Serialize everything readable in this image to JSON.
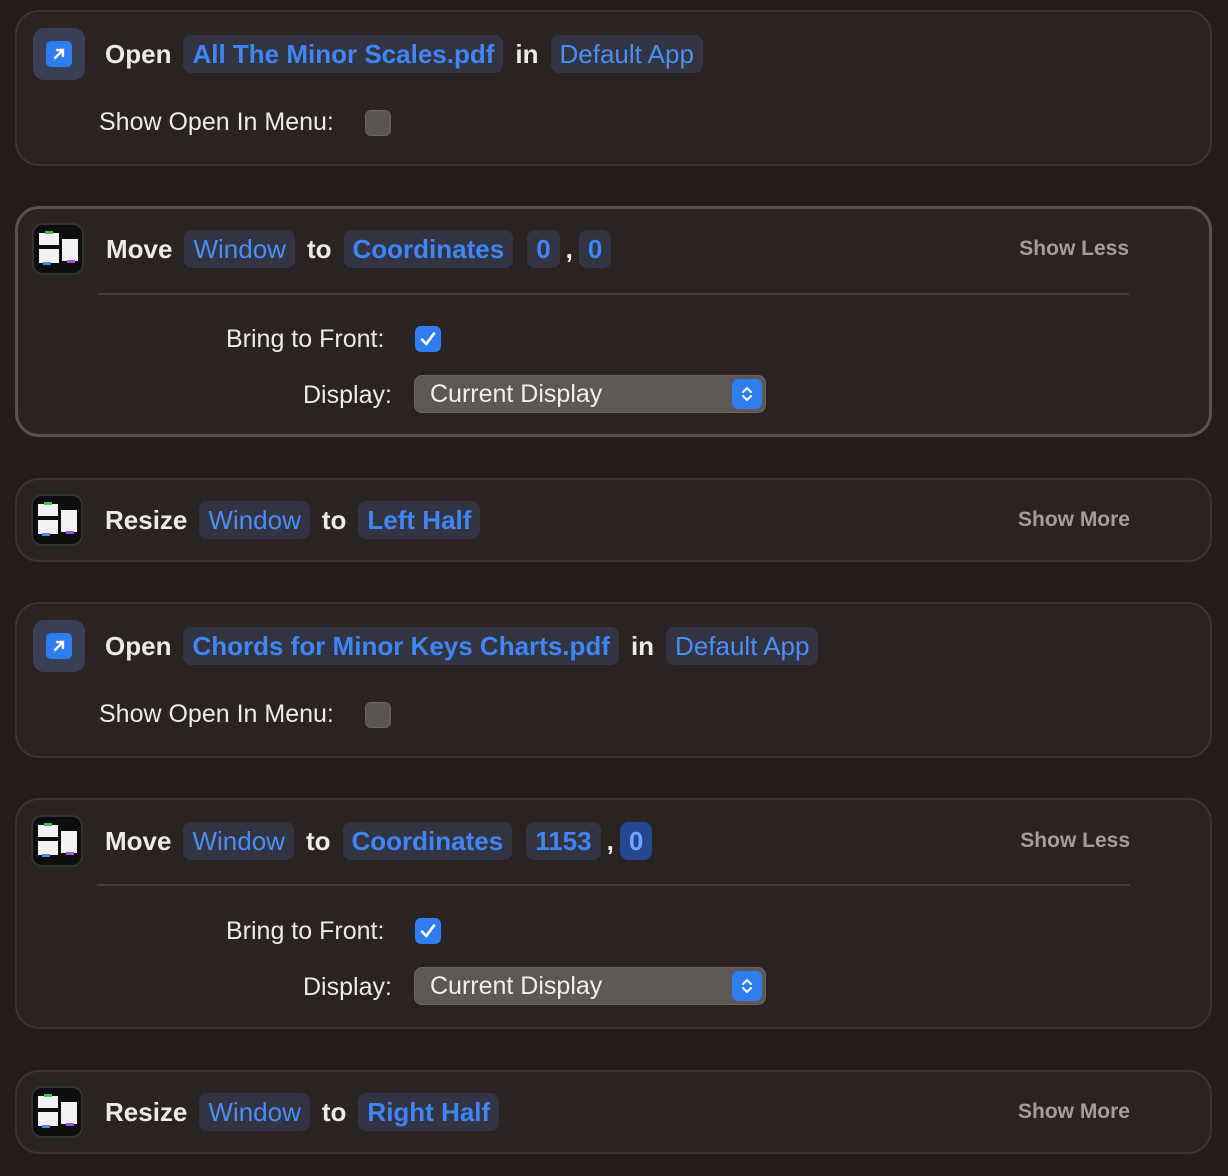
{
  "actions": [
    {
      "verb": "Open",
      "file": "All The Minor Scales.pdf",
      "in": "in",
      "app": "Default App",
      "option_label": "Show Open In Menu:"
    },
    {
      "verb": "Move",
      "target": "Window",
      "to": "to",
      "dest": "Coordinates",
      "x": "0",
      "comma": ",",
      "y": "0",
      "toggle": "Show Less",
      "bring_label": "Bring to Front:",
      "display_label": "Display:",
      "display_value": "Current Display"
    },
    {
      "verb": "Resize",
      "target": "Window",
      "to": "to",
      "size": "Left Half",
      "toggle": "Show More"
    },
    {
      "verb": "Open",
      "file": "Chords for Minor Keys Charts.pdf",
      "in": "in",
      "app": "Default App",
      "option_label": "Show Open In Menu:"
    },
    {
      "verb": "Move",
      "target": "Window",
      "to": "to",
      "dest": "Coordinates",
      "x": "1153",
      "comma": ",",
      "y": "0",
      "toggle": "Show Less",
      "bring_label": "Bring to Front:",
      "display_label": "Display:",
      "display_value": "Current Display"
    },
    {
      "verb": "Resize",
      "target": "Window",
      "to": "to",
      "size": "Right Half",
      "toggle": "Show More"
    }
  ],
  "colors": {
    "background": "#231c1a",
    "card": "#2a2321",
    "token_text": "#4a8ef5",
    "accent": "#2f7df0"
  },
  "icons": {
    "open": "open-file-arrow-icon",
    "window": "window-manager-icon"
  }
}
